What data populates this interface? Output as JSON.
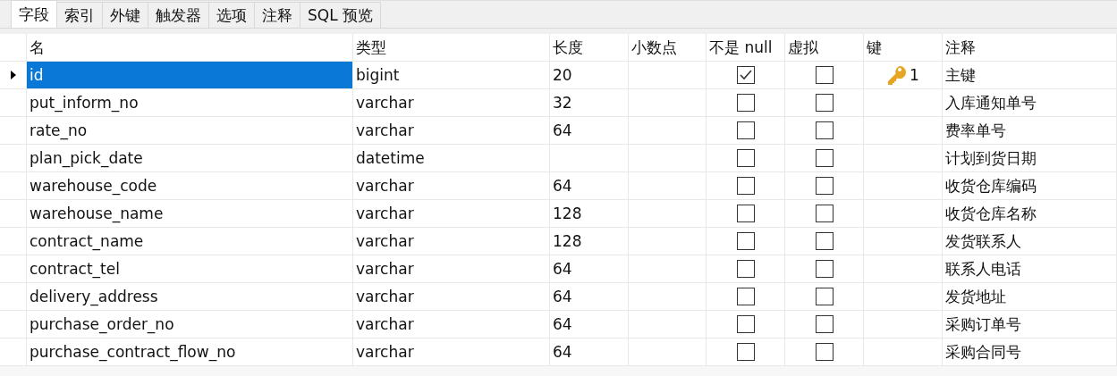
{
  "tabs": [
    {
      "label": "字段",
      "selected": true
    },
    {
      "label": "索引",
      "selected": false
    },
    {
      "label": "外键",
      "selected": false
    },
    {
      "label": "触发器",
      "selected": false
    },
    {
      "label": "选项",
      "selected": false
    },
    {
      "label": "注释",
      "selected": false
    },
    {
      "label": "SQL 预览",
      "selected": false
    }
  ],
  "table": {
    "columns": [
      "名",
      "类型",
      "长度",
      "小数点",
      "不是 null",
      "虚拟",
      "键",
      "注释"
    ],
    "rows": [
      {
        "name": "id",
        "type": "bigint",
        "length": "20",
        "not_null": true,
        "virtual": false,
        "key": "1",
        "comment": "主键",
        "selected": true
      },
      {
        "name": "put_inform_no",
        "type": "varchar",
        "length": "32",
        "not_null": false,
        "virtual": false,
        "comment": "入库通知单号",
        "selected": false
      },
      {
        "name": "rate_no",
        "type": "varchar",
        "length": "64",
        "not_null": false,
        "virtual": false,
        "comment": "费率单号",
        "selected": false
      },
      {
        "name": "plan_pick_date",
        "type": "datetime",
        "not_null": false,
        "virtual": false,
        "comment": "计划到货日期",
        "selected": false
      },
      {
        "name": "warehouse_code",
        "type": "varchar",
        "length": "64",
        "not_null": false,
        "virtual": false,
        "comment": "收货仓库编码",
        "selected": false
      },
      {
        "name": "warehouse_name",
        "type": "varchar",
        "length": "128",
        "not_null": false,
        "virtual": false,
        "comment": "收货仓库名称",
        "selected": false
      },
      {
        "name": "contract_name",
        "type": "varchar",
        "length": "128",
        "not_null": false,
        "virtual": false,
        "comment": "发货联系人",
        "selected": false
      },
      {
        "name": "contract_tel",
        "type": "varchar",
        "length": "64",
        "not_null": false,
        "virtual": false,
        "comment": "联系人电话",
        "selected": false
      },
      {
        "name": "delivery_address",
        "type": "varchar",
        "length": "64",
        "not_null": false,
        "virtual": false,
        "comment": "发货地址",
        "selected": false
      },
      {
        "name": "purchase_order_no",
        "type": "varchar",
        "length": "64",
        "not_null": false,
        "virtual": false,
        "comment": "采购订单号",
        "selected": false
      },
      {
        "name": "purchase_contract_flow_no",
        "type": "varchar",
        "length": "64",
        "not_null": false,
        "virtual": false,
        "comment": "采购合同号",
        "selected": false
      }
    ]
  }
}
